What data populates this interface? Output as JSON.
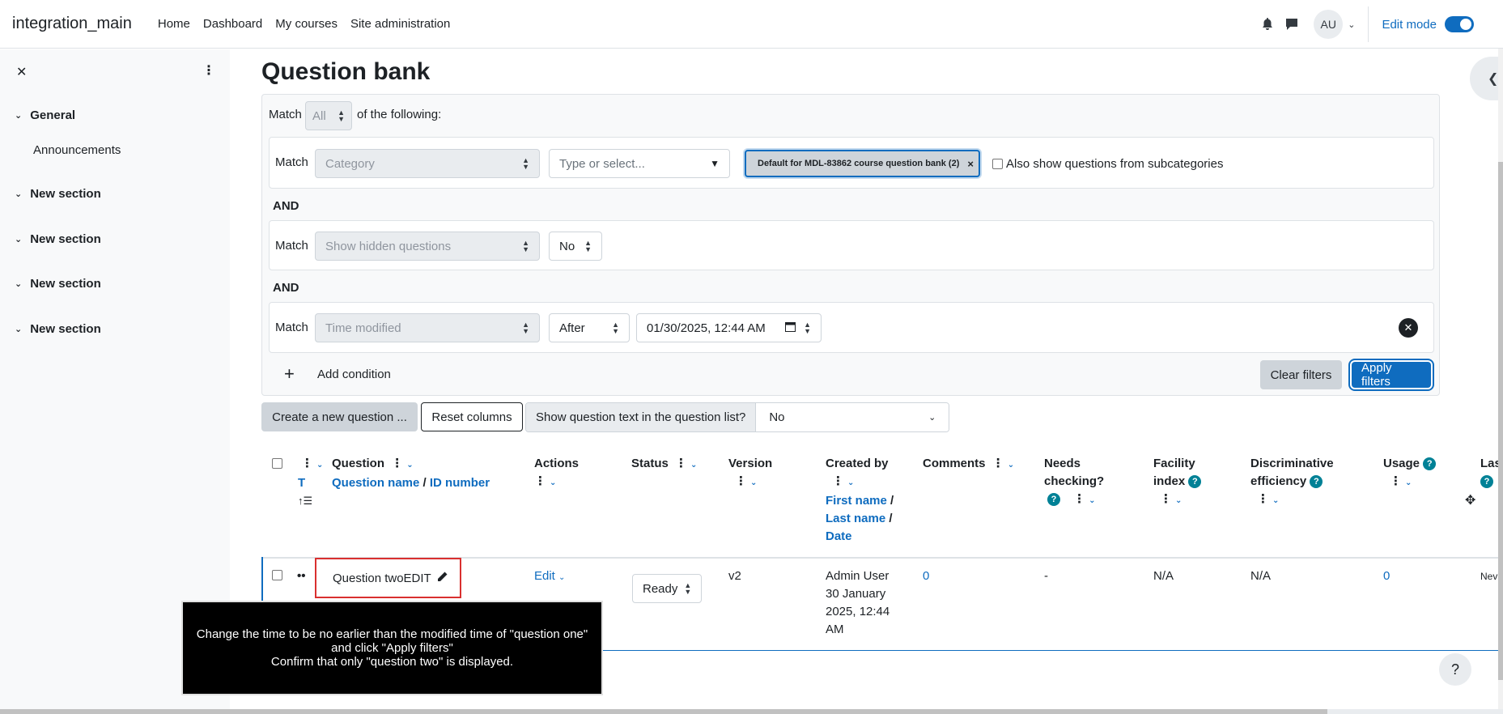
{
  "site_name": "integration_main",
  "primary_nav": [
    "Home",
    "Dashboard",
    "My courses",
    "Site administration"
  ],
  "user_initials": "AU",
  "edit_mode_label": "Edit mode",
  "drawer": {
    "sections": [
      {
        "label": "General",
        "items": [
          "Announcements"
        ]
      },
      {
        "label": "New section",
        "items": []
      },
      {
        "label": "New section",
        "items": []
      },
      {
        "label": "New section",
        "items": []
      },
      {
        "label": "New section",
        "items": []
      }
    ]
  },
  "page_title": "Question bank",
  "filters": {
    "match_label": "Match",
    "match_all_value": "All",
    "of_following": "of the following:",
    "and_label": "AND",
    "cond1": {
      "type": "Category",
      "placeholder": "Type or select...",
      "selected": "Default for MDL-83862 course question bank (2)",
      "subcat_label": "Also show questions from subcategories"
    },
    "cond2": {
      "type": "Show hidden questions",
      "value": "No"
    },
    "cond3": {
      "type": "Time modified",
      "operator": "After",
      "datetime": "01/30/2025, 12:44 AM"
    },
    "add_condition": "Add condition",
    "clear_filters": "Clear filters",
    "apply_filters": "Apply filters"
  },
  "toolbar": {
    "create_question": "Create a new question ...",
    "reset_columns": "Reset columns",
    "show_text_label": "Show question text in the question list?",
    "show_text_value": "No"
  },
  "table": {
    "headers": {
      "t": "T",
      "question": "Question",
      "question_name": "Question name",
      "id_number": "ID number",
      "actions": "Actions",
      "status": "Status",
      "version": "Version",
      "created_by": "Created by",
      "first_name": "First name",
      "last_name": "Last name",
      "date": "Date",
      "comments": "Comments",
      "needs_checking_1": "Needs",
      "needs_checking_2": "checking?",
      "facility_1": "Facility",
      "facility_2": "index",
      "discrim_1": "Discriminative",
      "discrim_2": "efficiency",
      "usage": "Usage",
      "last_used": "Las"
    },
    "row": {
      "name": "Question twoEDIT",
      "action": "Edit",
      "status": "Ready",
      "version": "v2",
      "created_1": "Admin User",
      "created_2": "30 January",
      "created_3": "2025, 12:44",
      "created_4": "AM",
      "comments": "0",
      "needs_checking": "-",
      "facility": "N/A",
      "discrim": "N/A",
      "usage": "0",
      "last_used": "Nev"
    }
  },
  "instruction": {
    "line1": "Change the time to be no earlier than the modified time of \"question one\" and click \"Apply filters\"",
    "line2": "Confirm that only \"question two\" is displayed."
  },
  "help_button": "?"
}
